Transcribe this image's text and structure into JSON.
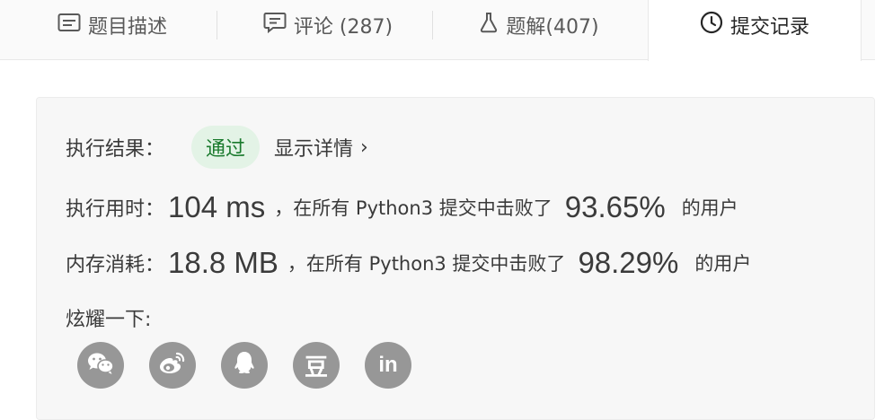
{
  "tabs": [
    {
      "label": "题目描述",
      "icon": "description-icon"
    },
    {
      "label": "评论 (287)",
      "icon": "comment-icon"
    },
    {
      "label": "题解(407)",
      "icon": "flask-icon"
    },
    {
      "label": "提交记录",
      "icon": "clock-icon",
      "active": true
    }
  ],
  "result": {
    "label": "执行结果：",
    "status": "通过",
    "details_link": "显示详情",
    "details_chevron": "›"
  },
  "runtime": {
    "label": "执行用时：",
    "value": "104 ms",
    "mid_text": "，在所有 Python3 提交中击败了",
    "percent": "93.65%",
    "suffix": "的用户"
  },
  "memory": {
    "label": "内存消耗：",
    "value": "18.8 MB",
    "mid_text": "，在所有 Python3 提交中击败了",
    "percent": "98.29%",
    "suffix": "的用户"
  },
  "share": {
    "label": "炫耀一下:",
    "items": [
      {
        "icon": "wechat-icon"
      },
      {
        "icon": "weibo-icon"
      },
      {
        "icon": "qq-icon"
      },
      {
        "icon": "douban-icon",
        "glyph": "豆"
      },
      {
        "icon": "linkedin-icon",
        "glyph": "in"
      }
    ]
  },
  "colors": {
    "pass_bg": "#e3f3e6",
    "pass_text": "#1a7a2d",
    "share_icon_bg": "#979797"
  }
}
